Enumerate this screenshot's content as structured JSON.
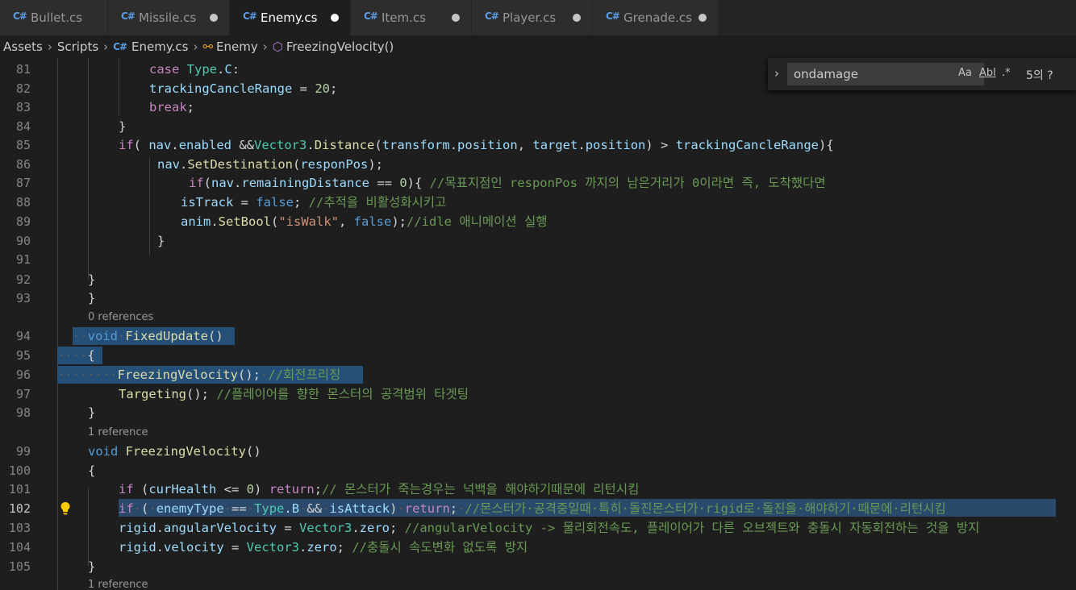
{
  "tabs": [
    {
      "label": "Bullet.cs",
      "dirty": false
    },
    {
      "label": "Missile.cs",
      "dirty": true
    },
    {
      "label": "Enemy.cs",
      "dirty": true,
      "active": true
    },
    {
      "label": "Item.cs",
      "dirty": true
    },
    {
      "label": "Player.cs",
      "dirty": true
    },
    {
      "label": "Grenade.cs",
      "dirty": true
    }
  ],
  "breadcrumb": {
    "items": [
      "Assets",
      "Scripts",
      "Enemy.cs",
      "Enemy",
      "FreezingVelocity()"
    ]
  },
  "find": {
    "query": "ondamage",
    "match_case": "Aa",
    "whole_word": "Abl",
    "regex": ".*",
    "result": "5의 ?"
  },
  "editor": {
    "current_line": "102",
    "codelens": [
      "0 references",
      "1 reference",
      "1 reference"
    ],
    "lines": [
      {
        "n": "81",
        "text": "case Type.C:"
      },
      {
        "n": "82",
        "text": "trackingCancleRange = 20;"
      },
      {
        "n": "83",
        "text": "break;"
      },
      {
        "n": "84",
        "text": "}"
      },
      {
        "n": "85",
        "text": "if( nav.enabled &&Vector3.Distance(transform.position, target.position) > trackingCancleRange){"
      },
      {
        "n": "86",
        "text": "nav.SetDestination(responPos);"
      },
      {
        "n": "87",
        "text": "if(nav.remainingDistance == 0){ //목표지점인 responPos 까지의 남은거리가 0이라면 즉, 도착했다면"
      },
      {
        "n": "88",
        "text": "isTrack = false; //추적을 비활성화시키고"
      },
      {
        "n": "89",
        "text": "anim.SetBool(\"isWalk\", false);//idle 애니메이션 실행"
      },
      {
        "n": "90",
        "text": "}"
      },
      {
        "n": "91",
        "text": ""
      },
      {
        "n": "92",
        "text": "}"
      },
      {
        "n": "93",
        "text": "}"
      },
      {
        "n": "94",
        "text": "void FixedUpdate()"
      },
      {
        "n": "95",
        "text": "{"
      },
      {
        "n": "96",
        "text": "FreezingVelocity(); //회전프리징"
      },
      {
        "n": "97",
        "text": "Targeting(); //플레이어를 향한 몬스터의 공격범위 타겟팅"
      },
      {
        "n": "98",
        "text": "}"
      },
      {
        "n": "99",
        "text": "void FreezingVelocity()"
      },
      {
        "n": "100",
        "text": "{"
      },
      {
        "n": "101",
        "text": "if (curHealth <= 0) return;// 몬스터가 죽는경우는 넉백을 해야하기때문에 리턴시킴"
      },
      {
        "n": "102",
        "text": "if ( enemyType == Type.B && isAttack) return; //몬스터가 공격중일때 특히 돌진몬스터가 rigid로 돌진을 해야하기 때문에 리턴시킴"
      },
      {
        "n": "103",
        "text": "rigid.angularVelocity = Vector3.zero; //angularVelocity -> 물리회전속도, 플레이어가 다른 오브젝트와 충돌시 자동회전하는 것을 방지"
      },
      {
        "n": "104",
        "text": "rigid.velocity = Vector3.zero; //충돌시 속도변화 없도록 방지"
      },
      {
        "n": "105",
        "text": "}"
      }
    ]
  }
}
